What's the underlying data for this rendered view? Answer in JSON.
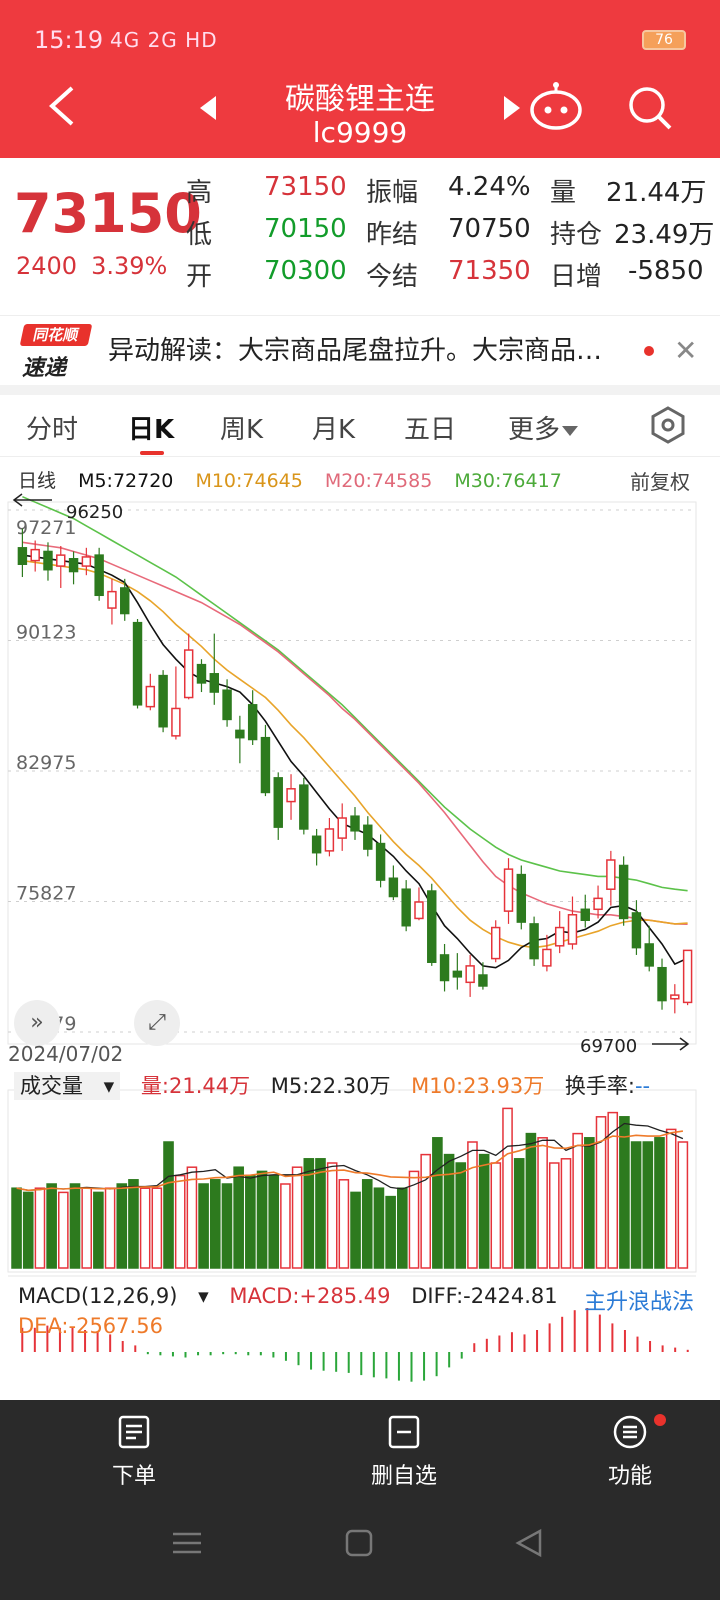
{
  "status_bar": {
    "time": "15:19",
    "signal": "4G 2G HD",
    "battery": "76"
  },
  "header": {
    "title": "碳酸锂主连",
    "code": "lc9999"
  },
  "quote": {
    "price": "73150",
    "change": "2400",
    "change_pct": "3.39%",
    "rows": [
      {
        "l1": "高",
        "v1": "73150",
        "l2": "振幅",
        "v2": "4.24%",
        "l3": "量",
        "v3": "21.44万"
      },
      {
        "l1": "低",
        "v1": "70150",
        "l2": "昨结",
        "v2": "70750",
        "l3": "持仓",
        "v3": "23.49万"
      },
      {
        "l1": "开",
        "v1": "70300",
        "l2": "今结",
        "v2": "71350",
        "l3": "日增",
        "v3": "-5850"
      }
    ]
  },
  "news": {
    "logo_top": "同花顺",
    "logo_bottom": "速递",
    "text": "异动解读：大宗商品尾盘拉升。大宗商品…"
  },
  "tabs": [
    "分时",
    "日K",
    "周K",
    "月K",
    "五日",
    "更多"
  ],
  "ma_line": {
    "label": "日线",
    "m5": "M5:72720",
    "m10": "M10:74645",
    "m20": "M20:74585",
    "m30": "M30:76417",
    "adjust": "前复权"
  },
  "colors": {
    "up": "#e5333a",
    "down": "#2d7a1e",
    "ma5": "#111111",
    "ma10": "#e8a42a",
    "ma20": "#e86a7a",
    "ma30": "#5cc24a",
    "header_bg": "#ee3a3f"
  },
  "chart_data": {
    "type": "candlestick",
    "y_ticks": [
      "97271",
      "90123",
      "82975",
      "75827",
      "68679"
    ],
    "ylim": [
      68679,
      97271
    ],
    "high_label": "96250",
    "low_label": "69700",
    "start_date": "2024/07/02",
    "candles": [
      {
        "o": 95200,
        "c": 94300,
        "h": 96250,
        "l": 93600
      },
      {
        "o": 94500,
        "c": 95100,
        "h": 95600,
        "l": 93900
      },
      {
        "o": 95000,
        "c": 94000,
        "h": 95500,
        "l": 93400
      },
      {
        "o": 94200,
        "c": 94800,
        "h": 95300,
        "l": 93000
      },
      {
        "o": 94600,
        "c": 93900,
        "h": 95000,
        "l": 93200
      },
      {
        "o": 94200,
        "c": 94700,
        "h": 95200,
        "l": 93700
      },
      {
        "o": 94800,
        "c": 92600,
        "h": 95200,
        "l": 92300
      },
      {
        "o": 91900,
        "c": 92800,
        "h": 93500,
        "l": 91000
      },
      {
        "o": 93000,
        "c": 91600,
        "h": 93500,
        "l": 91200
      },
      {
        "o": 91100,
        "c": 86600,
        "h": 91300,
        "l": 86400
      },
      {
        "o": 86500,
        "c": 87600,
        "h": 88300,
        "l": 86300
      },
      {
        "o": 88200,
        "c": 85400,
        "h": 88500,
        "l": 85100
      },
      {
        "o": 84900,
        "c": 86400,
        "h": 88700,
        "l": 84700
      },
      {
        "o": 87000,
        "c": 89600,
        "h": 90500,
        "l": 86900
      },
      {
        "o": 88800,
        "c": 87800,
        "h": 89100,
        "l": 87300
      },
      {
        "o": 88300,
        "c": 87300,
        "h": 90500,
        "l": 86600
      },
      {
        "o": 87400,
        "c": 85800,
        "h": 88000,
        "l": 85400
      },
      {
        "o": 85200,
        "c": 84800,
        "h": 86000,
        "l": 83400
      },
      {
        "o": 86600,
        "c": 84700,
        "h": 87400,
        "l": 84400
      },
      {
        "o": 84800,
        "c": 81800,
        "h": 85500,
        "l": 81600
      },
      {
        "o": 82600,
        "c": 79900,
        "h": 82900,
        "l": 79200
      },
      {
        "o": 81300,
        "c": 82000,
        "h": 82800,
        "l": 80300
      },
      {
        "o": 82200,
        "c": 79800,
        "h": 82600,
        "l": 79500
      },
      {
        "o": 79400,
        "c": 78500,
        "h": 79800,
        "l": 77800
      },
      {
        "o": 78600,
        "c": 79800,
        "h": 80400,
        "l": 78300
      },
      {
        "o": 79300,
        "c": 80400,
        "h": 81200,
        "l": 78600
      },
      {
        "o": 80500,
        "c": 79700,
        "h": 81000,
        "l": 79200
      },
      {
        "o": 80000,
        "c": 78700,
        "h": 80500,
        "l": 78300
      },
      {
        "o": 79000,
        "c": 77000,
        "h": 79500,
        "l": 76600
      },
      {
        "o": 77100,
        "c": 76100,
        "h": 77800,
        "l": 75900
      },
      {
        "o": 76500,
        "c": 74500,
        "h": 77000,
        "l": 74200
      },
      {
        "o": 74900,
        "c": 75800,
        "h": 76600,
        "l": 74800
      },
      {
        "o": 76400,
        "c": 72500,
        "h": 76800,
        "l": 72300
      },
      {
        "o": 72900,
        "c": 71500,
        "h": 73500,
        "l": 70900
      },
      {
        "o": 72000,
        "c": 71700,
        "h": 73000,
        "l": 71000
      },
      {
        "o": 71400,
        "c": 72300,
        "h": 72900,
        "l": 70600
      },
      {
        "o": 71800,
        "c": 71200,
        "h": 72500,
        "l": 71000
      },
      {
        "o": 72700,
        "c": 74400,
        "h": 74800,
        "l": 72500
      },
      {
        "o": 75300,
        "c": 77600,
        "h": 78200,
        "l": 74600
      },
      {
        "o": 77300,
        "c": 74700,
        "h": 77800,
        "l": 74300
      },
      {
        "o": 74600,
        "c": 72700,
        "h": 75000,
        "l": 72300
      },
      {
        "o": 72300,
        "c": 73200,
        "h": 74000,
        "l": 72000
      },
      {
        "o": 73400,
        "c": 74400,
        "h": 75300,
        "l": 73000
      },
      {
        "o": 73500,
        "c": 75100,
        "h": 76100,
        "l": 73200
      },
      {
        "o": 75400,
        "c": 74800,
        "h": 76200,
        "l": 74400
      },
      {
        "o": 75400,
        "c": 76000,
        "h": 76700,
        "l": 74900
      },
      {
        "o": 76500,
        "c": 78100,
        "h": 78600,
        "l": 75600
      },
      {
        "o": 77800,
        "c": 74900,
        "h": 78300,
        "l": 74500
      },
      {
        "o": 75200,
        "c": 73300,
        "h": 75900,
        "l": 72900
      },
      {
        "o": 73500,
        "c": 72300,
        "h": 74500,
        "l": 72000
      },
      {
        "o": 72200,
        "c": 70400,
        "h": 72700,
        "l": 69900
      },
      {
        "o": 70500,
        "c": 70700,
        "h": 71300,
        "l": 69700
      },
      {
        "o": 70300,
        "c": 73150,
        "h": 73150,
        "l": 70150
      }
    ],
    "ma5": [
      94800,
      94700,
      94600,
      94500,
      94400,
      94300,
      94000,
      93700,
      93300,
      92200,
      91000,
      89900,
      89100,
      88400,
      88000,
      87800,
      87600,
      87300,
      86600,
      85700,
      84600,
      83500,
      82700,
      81800,
      80900,
      80100,
      79800,
      79500,
      78900,
      78300,
      77500,
      76800,
      75600,
      74500,
      73800,
      73000,
      72300,
      72200,
      72600,
      73300,
      73700,
      73800,
      74200,
      74100,
      74300,
      74700,
      75500,
      75600,
      75300,
      74400,
      73500,
      72400,
      72720
    ],
    "ma10": [
      94500,
      94400,
      94300,
      94200,
      94100,
      94000,
      93800,
      93500,
      93200,
      92800,
      92300,
      91700,
      91000,
      90400,
      89800,
      89100,
      88500,
      88000,
      87500,
      87000,
      86300,
      85500,
      84800,
      84000,
      83200,
      82400,
      81600,
      80700,
      79900,
      79100,
      78400,
      77800,
      77100,
      76300,
      75500,
      74800,
      74300,
      73900,
      73600,
      73400,
      73300,
      73400,
      73600,
      73800,
      74000,
      74200,
      74500,
      74700,
      74800,
      74800,
      74700,
      74600,
      74645
    ],
    "ma20": [
      95500,
      95400,
      95300,
      95200,
      95000,
      94800,
      94600,
      94300,
      94000,
      93700,
      93400,
      93100,
      92800,
      92500,
      92200,
      91800,
      91400,
      91000,
      90500,
      90000,
      89500,
      88900,
      88300,
      87700,
      87100,
      86400,
      85800,
      85100,
      84400,
      83700,
      83000,
      82300,
      81500,
      80700,
      79800,
      78900,
      78000,
      77200,
      76700,
      76300,
      76000,
      75700,
      75500,
      75300,
      75200,
      75100,
      75100,
      75000,
      74900,
      74800,
      74700,
      74600,
      74585
    ],
    "ma30": [
      98000,
      97700,
      97400,
      97100,
      96800,
      96400,
      96000,
      95600,
      95200,
      94800,
      94400,
      94000,
      93600,
      93100,
      92600,
      92100,
      91600,
      91100,
      90600,
      90100,
      89600,
      89000,
      88400,
      87800,
      87200,
      86600,
      85900,
      85200,
      84500,
      83800,
      83100,
      82400,
      81700,
      81000,
      80400,
      79800,
      79300,
      78800,
      78400,
      78100,
      77900,
      77700,
      77500,
      77400,
      77300,
      77200,
      77200,
      77100,
      77000,
      76800,
      76600,
      76500,
      76417
    ]
  },
  "volume": {
    "selector": "成交量",
    "vol": "量:21.44万",
    "m5": "M5:22.30万",
    "m10": "M10:23.93万",
    "turnover_label": "换手率:",
    "turnover_value": "--",
    "values": [
      19,
      18,
      19,
      20,
      18,
      20,
      19,
      18,
      19,
      20,
      21,
      19,
      19,
      30,
      22,
      24,
      20,
      21,
      20,
      24,
      22,
      23,
      22,
      20,
      24,
      26,
      26,
      25,
      21,
      18,
      21,
      19,
      17,
      19,
      23,
      27,
      31,
      27,
      25,
      30,
      27,
      25,
      38,
      26,
      32,
      31,
      25,
      26,
      32,
      31,
      36,
      37,
      36,
      30,
      30,
      31,
      33,
      30
    ]
  },
  "macd": {
    "selector": "MACD(12,26,9)",
    "macd": "MACD:+285.49",
    "diff": "DIFF:-2424.81",
    "dea": "DEA:-2567.56",
    "strategy": "主升浪战法",
    "values": [
      22,
      22,
      24,
      22,
      22,
      20,
      19,
      16,
      10,
      6,
      -2,
      -3,
      -4,
      -5,
      -3,
      -3,
      -2,
      -2,
      -3,
      -3,
      -5,
      -8,
      -12,
      -16,
      -17,
      -18,
      -19,
      -21,
      -23,
      -24,
      -26,
      -27,
      -26,
      -22,
      -14,
      -6,
      8,
      12,
      15,
      18,
      16,
      20,
      26,
      32,
      38,
      40,
      34,
      26,
      20,
      14,
      10,
      6,
      4,
      2
    ]
  },
  "bottom_bar": [
    "下单",
    "删自选",
    "功能"
  ]
}
